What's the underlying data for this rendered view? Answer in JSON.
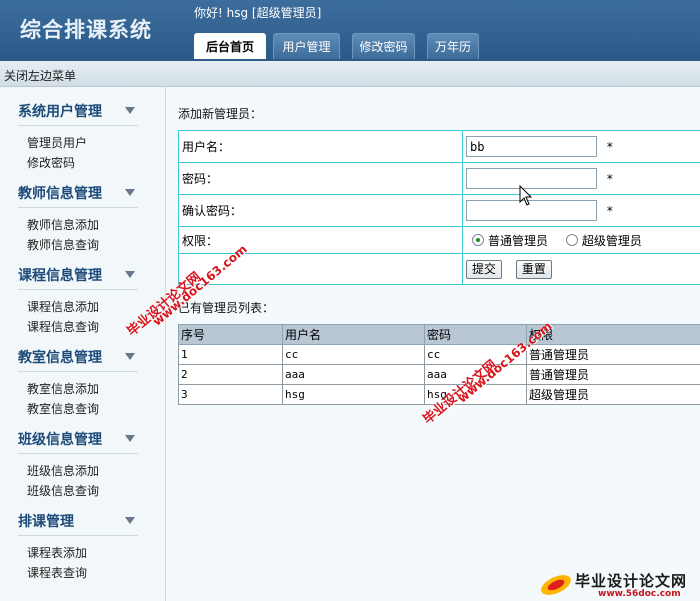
{
  "header": {
    "app_title": "综合排课系统",
    "greeting": "你好! hsg [超级管理员]",
    "tabs": [
      {
        "label": "后台首页",
        "active": true
      },
      {
        "label": "用户管理",
        "active": false
      },
      {
        "label": "修改密码",
        "active": false
      },
      {
        "label": "万年历",
        "active": false
      }
    ]
  },
  "toolbar": {
    "close_menu": "关闭左边菜单"
  },
  "sidebar": {
    "groups": [
      {
        "title": "系统用户管理",
        "items": [
          "管理员用户",
          "修改密码"
        ]
      },
      {
        "title": "教师信息管理",
        "items": [
          "教师信息添加",
          "教师信息查询"
        ]
      },
      {
        "title": "课程信息管理",
        "items": [
          "课程信息添加",
          "课程信息查询"
        ]
      },
      {
        "title": "教室信息管理",
        "items": [
          "教室信息添加",
          "教室信息查询"
        ]
      },
      {
        "title": "班级信息管理",
        "items": [
          "班级信息添加",
          "班级信息查询"
        ]
      },
      {
        "title": "排课管理",
        "items": [
          "课程表添加",
          "课程表查询"
        ]
      }
    ]
  },
  "form": {
    "heading": "添加新管理员：",
    "username_label": "用户名：",
    "username_value": "bb",
    "password_label": "密码：",
    "password_value": "",
    "confirm_label": "确认密码：",
    "confirm_value": "",
    "required_mark": "*",
    "role_label": "权限：",
    "role_options": [
      "普通管理员",
      "超级管理员"
    ],
    "role_selected": "普通管理员",
    "submit_label": "提交",
    "reset_label": "重置"
  },
  "admin_list": {
    "heading": "已有管理员列表：",
    "columns": [
      "序号",
      "用户名",
      "密码",
      "权限"
    ],
    "rows": [
      [
        "1",
        "cc",
        "cc",
        "普通管理员"
      ],
      [
        "2",
        "aaa",
        "aaa",
        "普通管理员"
      ],
      [
        "3",
        "hsg",
        "hsg",
        "超级管理员"
      ]
    ]
  },
  "watermarks": {
    "text_cn": "毕业设计论文网",
    "text_url": "www.doc163.com",
    "logo_text": "毕业设计论文网",
    "logo_url": "www.56doc.com"
  },
  "colors": {
    "header_bg": "#2f5f8e",
    "table_border": "#3ec9d1",
    "list_header_bg": "#b9c6d3",
    "watermark": "#d8151f"
  }
}
